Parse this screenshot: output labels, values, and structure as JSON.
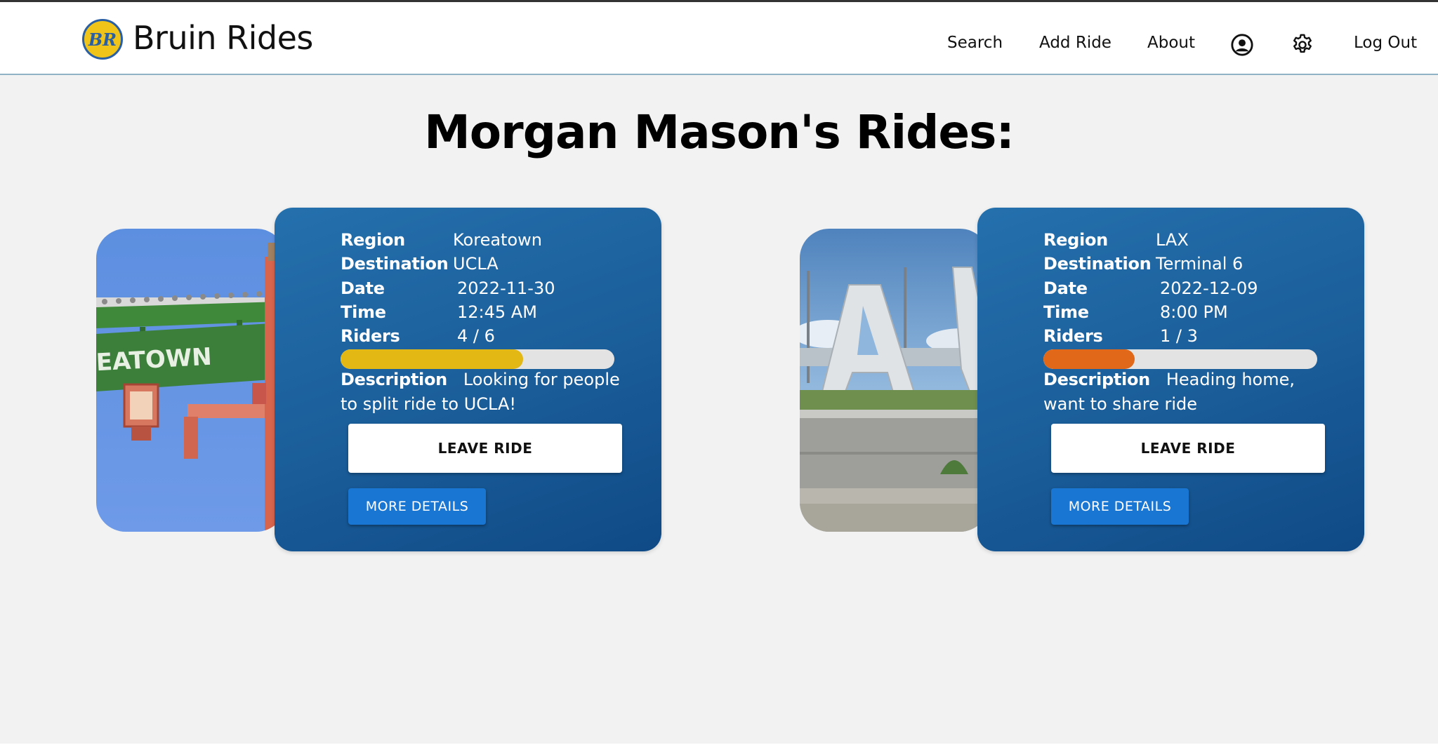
{
  "nav": {
    "brand_mark": "BR",
    "brand": "Bruin Rides",
    "links": {
      "search": "Search",
      "add_ride": "Add Ride",
      "about": "About",
      "logout": "Log Out"
    },
    "icons": {
      "profile": "account-circle-icon",
      "settings": "gear-icon"
    }
  },
  "page": {
    "title": "Morgan Mason's Rides:"
  },
  "labels": {
    "region": "Region",
    "destination": "Destination",
    "date": "Date",
    "time": "Time",
    "riders": "Riders",
    "description": "Description"
  },
  "rides": [
    {
      "region": "Koreatown",
      "destination": "UCLA",
      "date": "2022-11-30",
      "time": "12:45 AM",
      "riders": "4 / 6",
      "riders_fraction": 0.667,
      "progress_color": "#e3b714",
      "description": "Looking for people to split ride to UCLA!",
      "photo_sign": "EATOWN",
      "leave_label": "LEAVE RIDE",
      "details_label": "MORE DETAILS"
    },
    {
      "region": "LAX",
      "destination": "Terminal 6",
      "date": "2022-12-09",
      "time": "8:00 PM",
      "riders": "1 / 3",
      "riders_fraction": 0.333,
      "progress_color": "#e06818",
      "description": "Heading home, want to share ride",
      "photo_sign": "AX",
      "leave_label": "LEAVE RIDE",
      "details_label": "MORE DETAILS"
    }
  ],
  "colors": {
    "card_blue": "#1a5d99",
    "button_blue": "#1976d2",
    "page_bg": "#f2f2f2"
  }
}
